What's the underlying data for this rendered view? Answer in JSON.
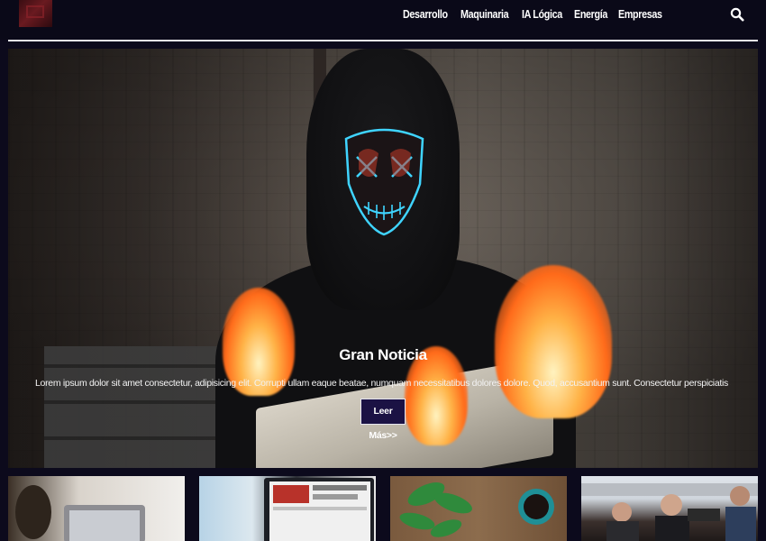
{
  "nav": {
    "items": [
      {
        "label": "Desarrollo"
      },
      {
        "label": "Maquinaria"
      },
      {
        "label": "IA Lógica"
      },
      {
        "label": "Energía"
      },
      {
        "label": "Empresas"
      }
    ],
    "search_icon": "search-icon"
  },
  "hero": {
    "title": "Gran Noticia",
    "text": "Lorem ipsum dolor sit amet consectetur, adipisicing elit. Corrupti ullam eaque beatae, numquam necessitatibus dolores dolore. Quod, accusantium sunt. Consectetur perspiciatis saepe cumque iste corrupti!",
    "button_label": "Leer Más>>"
  },
  "colors": {
    "header_bg": "#0a0918",
    "page_bg": "#0c0a1c",
    "button_bg": "#1b1244",
    "divider": "#e9e9ee"
  }
}
